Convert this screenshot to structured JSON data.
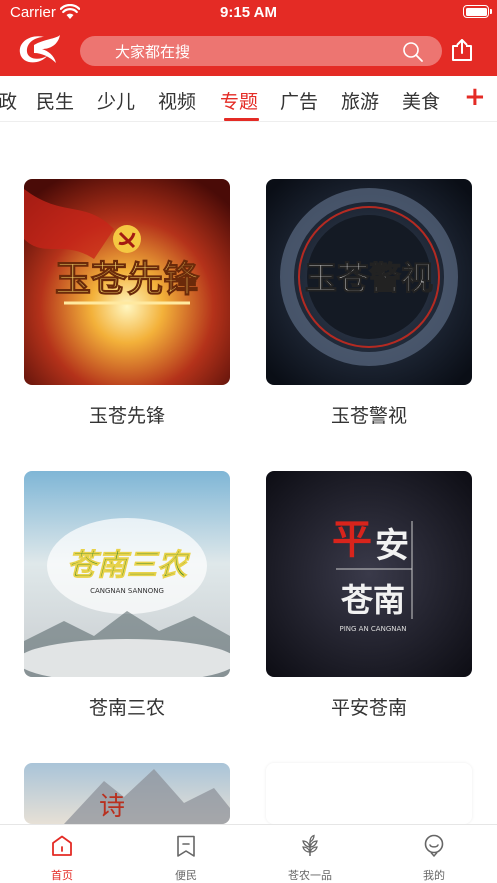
{
  "status_bar": {
    "carrier": "Carrier",
    "time": "9:15 AM"
  },
  "search": {
    "placeholder": "大家都在搜"
  },
  "tabs": [
    {
      "label": "政"
    },
    {
      "label": "民生"
    },
    {
      "label": "少儿"
    },
    {
      "label": "视频"
    },
    {
      "label": "专题",
      "active": true
    },
    {
      "label": "广告"
    },
    {
      "label": "旅游"
    },
    {
      "label": "美食"
    }
  ],
  "tab_add": "+",
  "cards": [
    {
      "title": "玉苍先锋",
      "thumb_text": "玉苍先锋"
    },
    {
      "title": "玉苍警视",
      "thumb_text": "玉苍警视"
    },
    {
      "title": "苍南三农",
      "thumb_text": "苍南三农",
      "thumb_subtext": "CANGNAN SANNONG"
    },
    {
      "title": "平安苍南",
      "thumb_text_1": "平",
      "thumb_text_2": "安",
      "thumb_text_3": "苍南",
      "thumb_subtext": "PING AN CANGNAN"
    },
    {
      "thumb_text": "诗"
    }
  ],
  "bottom_nav": [
    {
      "label": "首页",
      "icon": "home-icon",
      "active": true
    },
    {
      "label": "便民",
      "icon": "bookmark-icon"
    },
    {
      "label": "苍农一品",
      "icon": "leaf-icon"
    },
    {
      "label": "我的",
      "icon": "profile-icon"
    }
  ],
  "colors": {
    "brand_red": "#e42b25",
    "text": "#333333",
    "nav_inactive": "#666666"
  }
}
